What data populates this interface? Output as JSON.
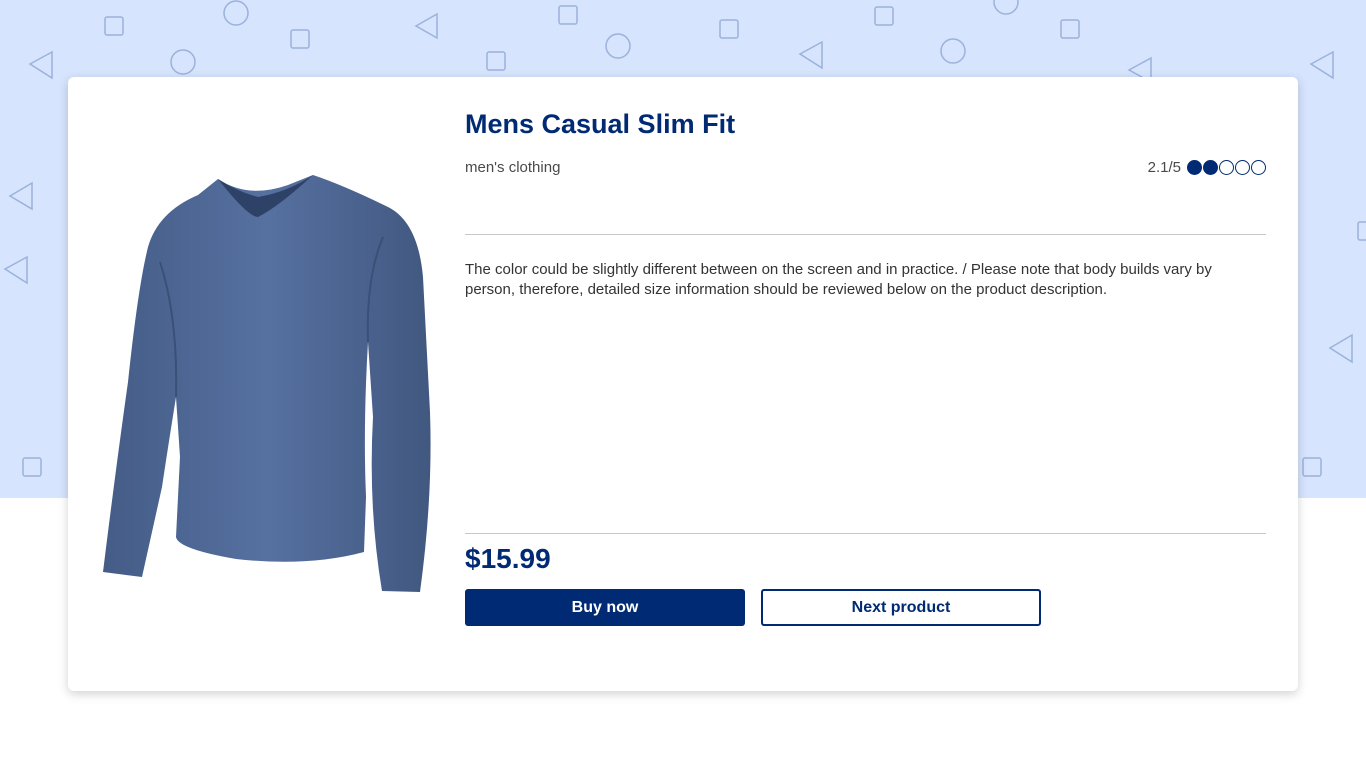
{
  "product": {
    "title": "Mens Casual Slim Fit",
    "category": "men's clothing",
    "rating_text": "2.1/5",
    "rating_value": 2.1,
    "rating_max": 5,
    "description": "The color could be slightly different between on the screen and in practice. / Please note that body builds vary by person, therefore, detailed size information should be reviewed below on the product description.",
    "price": "$15.99",
    "image_icon": "long-sleeve-shirt"
  },
  "actions": {
    "buy_label": "Buy now",
    "next_label": "Next product"
  },
  "colors": {
    "primary": "#002a73",
    "background_pattern": "#d6e4fd",
    "shirt": "#4f6790"
  }
}
